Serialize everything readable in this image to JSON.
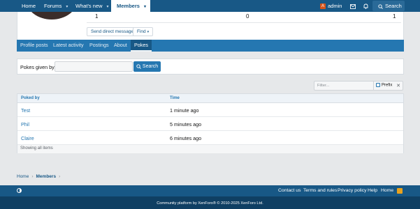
{
  "nav": {
    "home": "Home",
    "forums": "Forums",
    "whats_new": "What's new",
    "members": "Members",
    "user": "admin",
    "user_initial": "A",
    "search": "Search",
    "inbox_icon": "envelope-icon",
    "alerts_icon": "bell-icon"
  },
  "profile": {
    "stats": [
      "1",
      "0",
      "1"
    ],
    "send_direct_message": "Send direct message",
    "find": "Find"
  },
  "tabs": [
    "Profile posts",
    "Latest activity",
    "Postings",
    "About",
    "Pokes"
  ],
  "pokes": {
    "label": "Pokes given by",
    "input_value": "",
    "search_button": "Search"
  },
  "filter": {
    "placeholder": "Filter...",
    "prefix": "Prefix",
    "clear": "✕"
  },
  "table": {
    "headers": [
      "Poked by",
      "Time"
    ],
    "rows": [
      {
        "name": "Test",
        "time": "1 minute ago"
      },
      {
        "name": "Phil",
        "time": "5 minutes ago"
      },
      {
        "name": "Claire",
        "time": "6 minutes ago"
      }
    ],
    "footer": "Showing all items"
  },
  "breadcrumb": [
    "Home",
    "Members"
  ],
  "footer": {
    "links": [
      "Contact us",
      "Terms and rules",
      "Privacy policy",
      "Help",
      "Home"
    ],
    "copyright": "Community platform by XenForo® © 2010-2025 XenForo Ltd."
  },
  "colors": {
    "nav": "#185886",
    "tabs": "#2577b1",
    "footer_top": "#185886",
    "footer_bottom": "#0f3f63",
    "rss": "#e8a21e"
  }
}
